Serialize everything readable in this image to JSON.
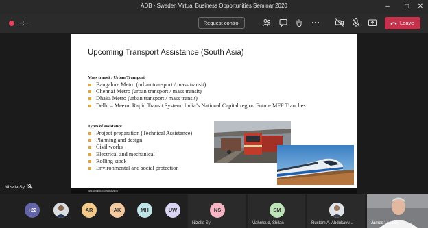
{
  "window": {
    "title": "ADB - Sweden Virtual Business Opportunities Seminar 2020"
  },
  "toolbar": {
    "timer": "--:--",
    "request_control_label": "Request control",
    "leave_label": "Leave",
    "leave_color": "#c4314b"
  },
  "slide": {
    "title": "Upcoming Transport Assistance (South Asia)",
    "section1_heading": "Mass transit / Urban Transport",
    "section1_items": [
      "Bangalore Metro (urban transport / mass transit)",
      "Chennai Metro (urban transport / mass transit)",
      "Dhaka Metro (urban transport / mass transit)",
      "Delhi – Meerut Rapid Transit System: India’s National Capital region Future MFF Tranches"
    ],
    "section2_heading": "Types of assistance",
    "section2_items": [
      "Project preparation (Technical Assistance)",
      "Planning and design",
      "Civil works",
      "Electrical and mechanical",
      "Rolling stock",
      "Environmental and social protection"
    ],
    "footer_text": "BUSINESS SWEDEN",
    "bullet_color": "#e8a23a"
  },
  "presenter": {
    "name": "Nizelle Sy"
  },
  "gallery": {
    "overflow_count": "+22",
    "avatars": [
      {
        "initials": "AR",
        "color": "#f2c98a"
      },
      {
        "initials": "AK",
        "color": "#f3c9a0"
      },
      {
        "initials": "MH",
        "color": "#bfe3e6"
      },
      {
        "initials": "UW",
        "color": "#d8d4f2"
      }
    ],
    "tiles": [
      {
        "initials": "NS",
        "name": "Nizelle Sy",
        "color": "#f5b5c4"
      },
      {
        "initials": "SM",
        "name": "Mahmoud, Shilan",
        "color": "#bfe3b8"
      },
      {
        "initials": "",
        "name": "Rustam A. Abdukayu...",
        "color": ""
      },
      {
        "initials": "",
        "name": "James Leather",
        "color": ""
      }
    ]
  }
}
